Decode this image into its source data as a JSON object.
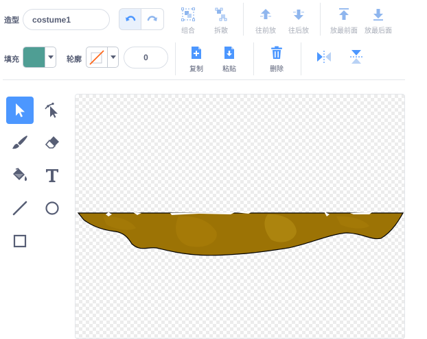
{
  "toolbar": {
    "costume_label": "造型",
    "costume_name": "costume1",
    "group": "组合",
    "ungroup": "拆散",
    "forward": "往前放",
    "backward": "往后放",
    "front": "放最前面",
    "back": "放最后面",
    "fill_label": "填充",
    "outline_label": "轮廓",
    "outline_width": "0",
    "copy": "复制",
    "paste": "粘贴",
    "delete": "删除"
  },
  "colors": {
    "accent": "#4c97ff",
    "fill_swatch": "#4f9e94",
    "outline_slash": "#ff661a",
    "delete_icon": "#4c97ff",
    "disabled_icon": "#8fb6ee",
    "shape_fill": "#9c7305",
    "shape_highlight": "#b18a12"
  },
  "tools": [
    {
      "name": "select-tool",
      "icon": "arrow-cursor-icon",
      "active": true
    },
    {
      "name": "reshape-tool",
      "icon": "reshape-cursor-icon",
      "active": false
    },
    {
      "name": "brush-tool",
      "icon": "brush-icon",
      "active": false
    },
    {
      "name": "eraser-tool",
      "icon": "eraser-icon",
      "active": false
    },
    {
      "name": "fill-tool",
      "icon": "paint-bucket-icon",
      "active": false
    },
    {
      "name": "text-tool",
      "icon": "text-T-icon",
      "active": false
    },
    {
      "name": "line-tool",
      "icon": "line-icon",
      "active": false
    },
    {
      "name": "circle-tool",
      "icon": "circle-icon",
      "active": false
    },
    {
      "name": "rectangle-tool",
      "icon": "rectangle-icon",
      "active": false
    }
  ]
}
